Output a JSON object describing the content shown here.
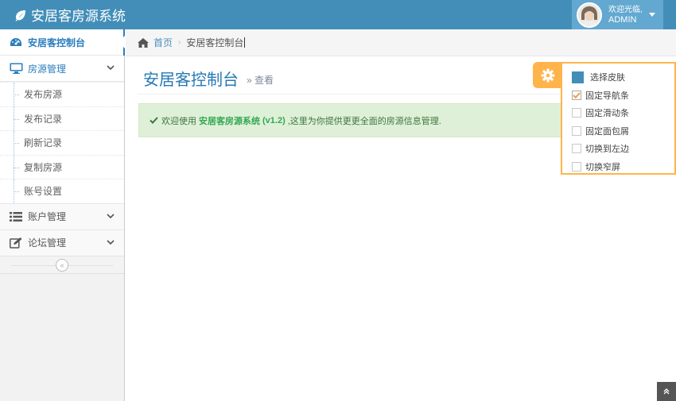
{
  "navbar": {
    "brand": "安居客房源系统",
    "user_welcome": "欢迎光临,",
    "user_name": "ADMIN"
  },
  "sidebar": {
    "items": [
      {
        "label": "安居客控制台",
        "icon": "dashboard-icon"
      },
      {
        "label": "房源管理",
        "icon": "desktop-icon"
      },
      {
        "label": "账户管理",
        "icon": "list-icon"
      },
      {
        "label": "论坛管理",
        "icon": "edit-icon"
      }
    ],
    "submenu": [
      "发布房源",
      "发布记录",
      "刷新记录",
      "复制房源",
      "账号设置"
    ],
    "collapse_icon": "«"
  },
  "breadcrumb": {
    "home": "首页",
    "current": "安居客控制台"
  },
  "page": {
    "title": "安居客控制台",
    "subtitle": "» 查看"
  },
  "alert": {
    "prefix": "欢迎使用",
    "product": "安居客房源系统",
    "version": "(v1.2)",
    "suffix": ",这里为你提供更更全面的房源信息管理."
  },
  "settings": {
    "skin_label": "选择皮肤",
    "options": [
      {
        "label": "固定导航条",
        "checked": true
      },
      {
        "label": "固定滑动条",
        "checked": false
      },
      {
        "label": "固定面包屑",
        "checked": false
      },
      {
        "label": "切换到左边",
        "checked": false
      },
      {
        "label": "切换窄屏",
        "checked": false
      }
    ]
  },
  "colors": {
    "navbar": "#438eb9",
    "accent": "#2679b5",
    "settings_border": "#ffb44b",
    "alert_bg": "#dff0d8"
  }
}
